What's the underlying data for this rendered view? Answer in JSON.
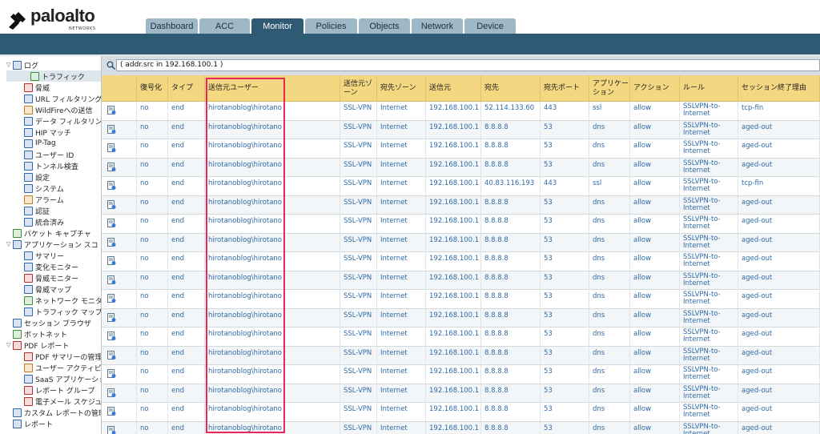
{
  "brand": {
    "name": "paloalto",
    "sub": "NETWORKS"
  },
  "tabs": [
    {
      "label": "Dashboard"
    },
    {
      "label": "ACC"
    },
    {
      "label": "Monitor"
    },
    {
      "label": "Policies"
    },
    {
      "label": "Objects"
    },
    {
      "label": "Network"
    },
    {
      "label": "Device"
    }
  ],
  "active_tab": "Monitor",
  "sidebar": {
    "items": [
      {
        "label": "ログ",
        "toggle": "▽"
      },
      {
        "label": "トラフィック"
      },
      {
        "label": "脅威"
      },
      {
        "label": "URL フィルタリング"
      },
      {
        "label": "WildFireへの送信"
      },
      {
        "label": "データ フィルタリン"
      },
      {
        "label": "HIP マッチ"
      },
      {
        "label": "IP-Tag"
      },
      {
        "label": "ユーザー ID"
      },
      {
        "label": "トンネル検査"
      },
      {
        "label": "設定"
      },
      {
        "label": "システム"
      },
      {
        "label": "アラーム"
      },
      {
        "label": "認証"
      },
      {
        "label": "統合済み"
      },
      {
        "label": "パケット キャプチャ"
      },
      {
        "label": "アプリケーション スコ",
        "toggle": "▽"
      },
      {
        "label": "サマリー"
      },
      {
        "label": "変化モニター"
      },
      {
        "label": "脅威モニター"
      },
      {
        "label": "脅威マップ"
      },
      {
        "label": "ネットワーク モニタ"
      },
      {
        "label": "トラフィック マップ"
      },
      {
        "label": "セッション ブラウザ"
      },
      {
        "label": "ボットネット"
      },
      {
        "label": "PDF レポート",
        "toggle": "▽"
      },
      {
        "label": "PDF サマリーの管理"
      },
      {
        "label": "ユーザー アクティビ"
      },
      {
        "label": "SaaS アプリケーショ"
      },
      {
        "label": "レポート グループ"
      },
      {
        "label": "電子メール スケジュ"
      },
      {
        "label": "カスタム レポートの管理"
      },
      {
        "label": "レポート"
      }
    ]
  },
  "filter": {
    "value": "( addr.src in 192.168.100.1 )"
  },
  "table": {
    "columns": [
      "",
      "復号化",
      "タイプ",
      "送信元ユーザー",
      "送信元ゾーン",
      "宛先ゾーン",
      "送信元",
      "宛先",
      "宛先ポート",
      "アプリケーション",
      "アクション",
      "ルール",
      "セッション終了理由"
    ],
    "rows": [
      [
        "no",
        "end",
        "hirotanoblog\\hirotano",
        "SSL-VPN",
        "Internet",
        "192.168.100.1",
        "52.114.133.60",
        "443",
        "ssl",
        "allow",
        "SSLVPN-to-Internet",
        "tcp-fin"
      ],
      [
        "no",
        "end",
        "hirotanoblog\\hirotano",
        "SSL-VPN",
        "Internet",
        "192.168.100.1",
        "8.8.8.8",
        "53",
        "dns",
        "allow",
        "SSLVPN-to-Internet",
        "aged-out"
      ],
      [
        "no",
        "end",
        "hirotanoblog\\hirotano",
        "SSL-VPN",
        "Internet",
        "192.168.100.1",
        "8.8.8.8",
        "53",
        "dns",
        "allow",
        "SSLVPN-to-Internet",
        "aged-out"
      ],
      [
        "no",
        "end",
        "hirotanoblog\\hirotano",
        "SSL-VPN",
        "Internet",
        "192.168.100.1",
        "8.8.8.8",
        "53",
        "dns",
        "allow",
        "SSLVPN-to-Internet",
        "aged-out"
      ],
      [
        "no",
        "end",
        "hirotanoblog\\hirotano",
        "SSL-VPN",
        "Internet",
        "192.168.100.1",
        "40.83.116.193",
        "443",
        "ssl",
        "allow",
        "SSLVPN-to-Internet",
        "tcp-fin"
      ],
      [
        "no",
        "end",
        "hirotanoblog\\hirotano",
        "SSL-VPN",
        "Internet",
        "192.168.100.1",
        "8.8.8.8",
        "53",
        "dns",
        "allow",
        "SSLVPN-to-Internet",
        "aged-out"
      ],
      [
        "no",
        "end",
        "hirotanoblog\\hirotano",
        "SSL-VPN",
        "Internet",
        "192.168.100.1",
        "8.8.8.8",
        "53",
        "dns",
        "allow",
        "SSLVPN-to-Internet",
        "aged-out"
      ],
      [
        "no",
        "end",
        "hirotanoblog\\hirotano",
        "SSL-VPN",
        "Internet",
        "192.168.100.1",
        "8.8.8.8",
        "53",
        "dns",
        "allow",
        "SSLVPN-to-Internet",
        "aged-out"
      ],
      [
        "no",
        "end",
        "hirotanoblog\\hirotano",
        "SSL-VPN",
        "Internet",
        "192.168.100.1",
        "8.8.8.8",
        "53",
        "dns",
        "allow",
        "SSLVPN-to-Internet",
        "aged-out"
      ],
      [
        "no",
        "end",
        "hirotanoblog\\hirotano",
        "SSL-VPN",
        "Internet",
        "192.168.100.1",
        "8.8.8.8",
        "53",
        "dns",
        "allow",
        "SSLVPN-to-Internet",
        "aged-out"
      ],
      [
        "no",
        "end",
        "hirotanoblog\\hirotano",
        "SSL-VPN",
        "Internet",
        "192.168.100.1",
        "8.8.8.8",
        "53",
        "dns",
        "allow",
        "SSLVPN-to-Internet",
        "aged-out"
      ],
      [
        "no",
        "end",
        "hirotanoblog\\hirotano",
        "SSL-VPN",
        "Internet",
        "192.168.100.1",
        "8.8.8.8",
        "53",
        "dns",
        "allow",
        "SSLVPN-to-Internet",
        "aged-out"
      ],
      [
        "no",
        "end",
        "hirotanoblog\\hirotano",
        "SSL-VPN",
        "Internet",
        "192.168.100.1",
        "8.8.8.8",
        "53",
        "dns",
        "allow",
        "SSLVPN-to-Internet",
        "aged-out"
      ],
      [
        "no",
        "end",
        "hirotanoblog\\hirotano",
        "SSL-VPN",
        "Internet",
        "192.168.100.1",
        "8.8.8.8",
        "53",
        "dns",
        "allow",
        "SSLVPN-to-Internet",
        "aged-out"
      ],
      [
        "no",
        "end",
        "hirotanoblog\\hirotano",
        "SSL-VPN",
        "Internet",
        "192.168.100.1",
        "8.8.8.8",
        "53",
        "dns",
        "allow",
        "SSLVPN-to-Internet",
        "aged-out"
      ],
      [
        "no",
        "end",
        "hirotanoblog\\hirotano",
        "SSL-VPN",
        "Internet",
        "192.168.100.1",
        "8.8.8.8",
        "53",
        "dns",
        "allow",
        "SSLVPN-to-Internet",
        "aged-out"
      ],
      [
        "no",
        "end",
        "hirotanoblog\\hirotano",
        "SSL-VPN",
        "Internet",
        "192.168.100.1",
        "8.8.8.8",
        "53",
        "dns",
        "allow",
        "SSLVPN-to-Internet",
        "aged-out"
      ],
      [
        "no",
        "end",
        "hirotanoblog\\hirotano",
        "SSL-VPN",
        "Internet",
        "192.168.100.1",
        "8.8.8.8",
        "53",
        "dns",
        "allow",
        "SSLVPN-to-Internet",
        "aged-out"
      ]
    ]
  },
  "colors": {
    "nav": "#2f5a74",
    "header_row": "#f4d781",
    "link": "#2e6aa6",
    "highlight": "#e8265a"
  }
}
